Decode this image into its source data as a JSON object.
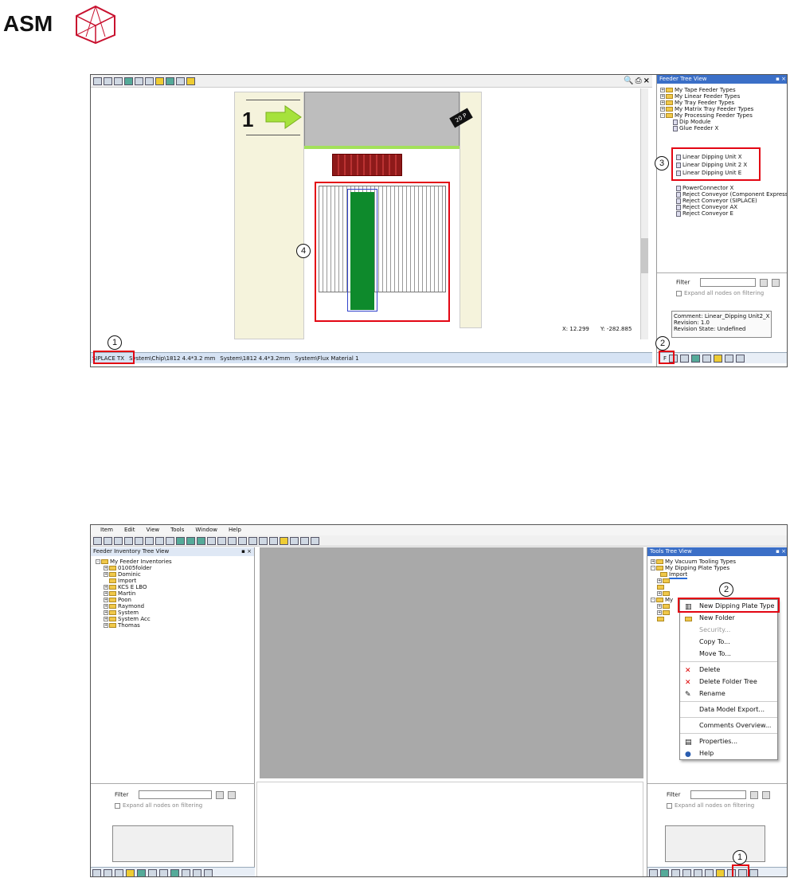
{
  "logo": {
    "text": "ASM"
  },
  "shot1": {
    "canvas": {
      "arrow_number": "1",
      "feeder_label": "20 P"
    },
    "coords": {
      "x": "X:  12.299",
      "y": "Y:  -282.885"
    },
    "statusbar": {
      "items": [
        "SIPLACE TX",
        "System\\Chip\\1812 4.4*3.2 mm",
        "System\\1812 4.4*3.2mm",
        "System\\Flux Material 1"
      ],
      "right_tab": "F"
    },
    "panel": {
      "title": "Feeder Tree View",
      "tree": [
        "My Tape Feeder Types",
        "My Linear Feeder Types",
        "My Tray Feeder Types",
        "My Matrix Tray Feeder Types",
        "My Processing Feeder Types",
        "Dip Module",
        "Glue Feeder X"
      ],
      "highlighted": [
        "Linear Dipping Unit X",
        "Linear Dipping Unit 2 X",
        "Linear Dipping Unit E"
      ],
      "tree2": [
        "PowerConnector X",
        "Reject Conveyor (Component Express)",
        "Reject Conveyor (SIPLACE)",
        "Reject Conveyor AX",
        "Reject Conveyor E"
      ],
      "filter_label": "Filter",
      "expand_label": "Expand all nodes on filtering",
      "info": [
        "Comment: Linear_Dipping Unit2_X",
        "Revision: 1.0",
        "Revision State: Undefined"
      ]
    },
    "callouts": [
      "1",
      "2",
      "3",
      "4"
    ]
  },
  "shot2": {
    "menubar": [
      "Item",
      "Edit",
      "View",
      "Tools",
      "Window",
      "Help"
    ],
    "left_panel": {
      "title": "Feeder Inventory Tree View",
      "root": "My Feeder Inventories",
      "items": [
        "01005folder",
        "Dominic",
        "Import",
        "KCS E LBO",
        "Martin",
        "Poon",
        "Raymond",
        "System",
        "System Acc",
        "Thomas"
      ],
      "filter_label": "Filter",
      "expand_label": "Expand all nodes on filtering"
    },
    "right_panel": {
      "title": "Tools Tree View",
      "items": [
        "My Vacuum Tooling Types",
        "My Dipping Plate Types",
        "Import",
        "My"
      ],
      "filter_label": "Filter",
      "expand_label": "Expand all nodes on filtering"
    },
    "context_menu": {
      "items": [
        "New Dipping Plate Type",
        "New Folder",
        "Security...",
        "Copy To...",
        "Move To...",
        "Delete",
        "Delete Folder Tree",
        "Rename",
        "Data Model Export...",
        "Comments Overview...",
        "Properties...",
        "Help"
      ]
    },
    "callouts": [
      "1",
      "2"
    ]
  },
  "colors": {
    "highlight_red": "#e30613",
    "accent_blue": "#3b6fc7",
    "feeder_green": "#0e8a2c"
  }
}
